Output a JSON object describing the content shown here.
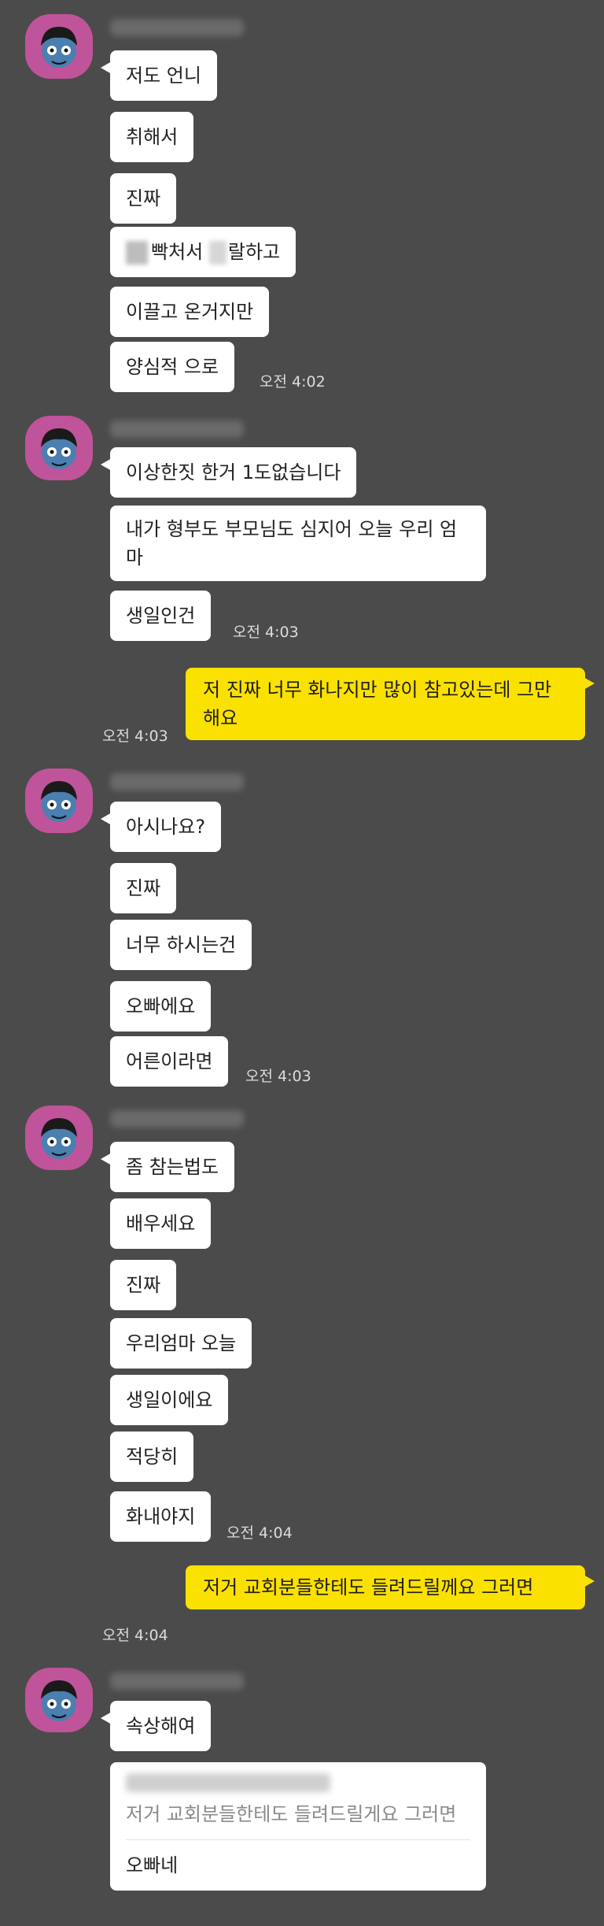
{
  "colors": {
    "background": "#4b4b4b",
    "incoming_bubble": "#ffffff",
    "outgoing_bubble": "#fae100",
    "avatar_bg": "#c0549a"
  },
  "groups": [
    {
      "messages": [
        "저도 언니",
        "취해서",
        "진짜",
        "빡처서",
        "이끌고 온거지만",
        "양심적 으로"
      ],
      "fragment": "랄하고",
      "time": "오전 4:02"
    },
    {
      "messages": [
        "이상한짓 한거 1도없습니다",
        "내가 형부도 부모님도 심지어 오늘 우리 엄마",
        "생일인건"
      ],
      "time": "오전 4:03"
    },
    {
      "messages": [
        "아시나요?",
        "진짜",
        "너무 하시는건",
        "오빠에요",
        "어른이라면"
      ],
      "time": "오전 4:03"
    },
    {
      "messages": [
        "좀 참는법도",
        "배우세요",
        "진짜",
        "우리엄마 오늘",
        "생일이에요",
        "적당히",
        "화내야지"
      ],
      "time": "오전 4:04"
    },
    {
      "messages": [
        "속상해여"
      ],
      "reply": {
        "quote": "저거 교회분들한테도 들려드릴게요 그러면",
        "text": "오빠네"
      }
    }
  ],
  "outgoing": [
    {
      "text": "저 진짜 너무 화나지만 많이 참고있는데 그만해요",
      "time": "오전 4:03"
    },
    {
      "text": "저거 교회분들한테도 들려드릴께요 그러면",
      "time": "오전 4:04"
    }
  ]
}
